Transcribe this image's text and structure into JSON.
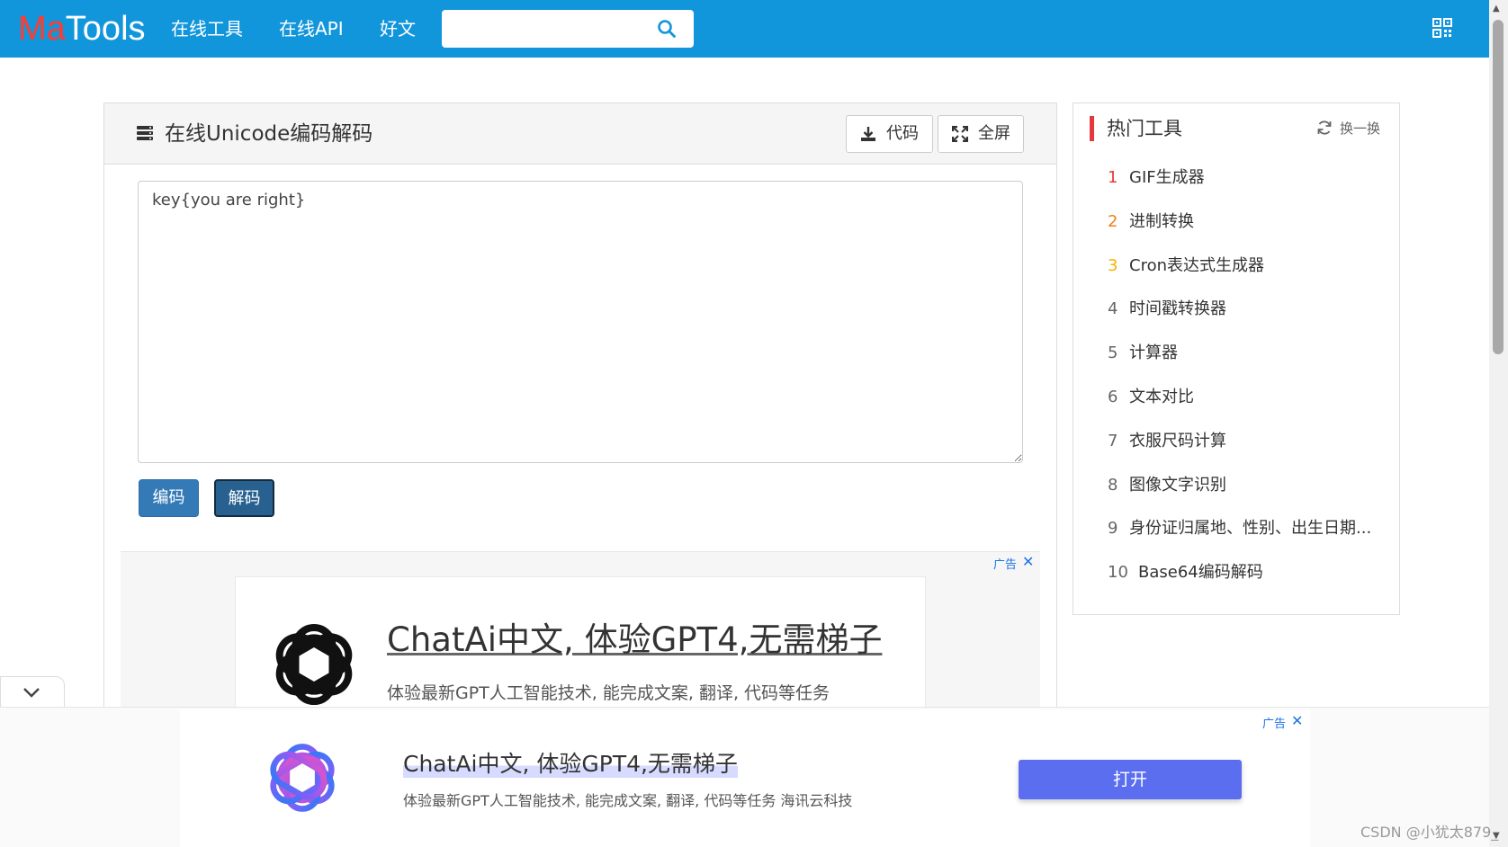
{
  "header": {
    "logo_part1": "Ma",
    "logo_part2": "Tools",
    "nav": [
      "在线工具",
      "在线API",
      "好文"
    ],
    "search_value": "",
    "brand_color": "#1296db"
  },
  "tool": {
    "title": "在线Unicode编码解码",
    "code_button": "代码",
    "fullscreen_button": "全屏",
    "input_text": "key{you are right}",
    "encode_button": "编码",
    "decode_button": "解码"
  },
  "inline_ad": {
    "tag": "广告",
    "close": "✕",
    "title": "ChatAi中文, 体验GPT4,无需梯子",
    "desc": "体验最新GPT人工智能技术, 能完成文案, 翻译, 代码等任务"
  },
  "sidebar": {
    "title": "热门工具",
    "refresh_label": "换一换",
    "accent_color": "#e4393c",
    "items": [
      {
        "num": "1",
        "label": "GIF生成器",
        "num_color": "#e4393c"
      },
      {
        "num": "2",
        "label": "进制转换",
        "num_color": "#f0801a"
      },
      {
        "num": "3",
        "label": "Cron表达式生成器",
        "num_color": "#f5b400"
      },
      {
        "num": "4",
        "label": "时间戳转换器",
        "num_color": "#666666"
      },
      {
        "num": "5",
        "label": "计算器",
        "num_color": "#666666"
      },
      {
        "num": "6",
        "label": "文本对比",
        "num_color": "#666666"
      },
      {
        "num": "7",
        "label": "衣服尺码计算",
        "num_color": "#666666"
      },
      {
        "num": "8",
        "label": "图像文字识别",
        "num_color": "#666666"
      },
      {
        "num": "9",
        "label": "身份证归属地、性别、出生日期...",
        "num_color": "#666666"
      },
      {
        "num": "10",
        "label": "Base64编码解码",
        "num_color": "#666666"
      }
    ]
  },
  "bottom_ad": {
    "tag": "广告",
    "close": "✕",
    "title": "ChatAi中文, 体验GPT4,无需梯子",
    "desc": "体验最新GPT人工智能技术, 能完成文案, 翻译, 代码等任务 海讯云科技",
    "open_button": "打开",
    "button_color": "#5b6ef0"
  },
  "watermark": "CSDN @小犹太879_"
}
